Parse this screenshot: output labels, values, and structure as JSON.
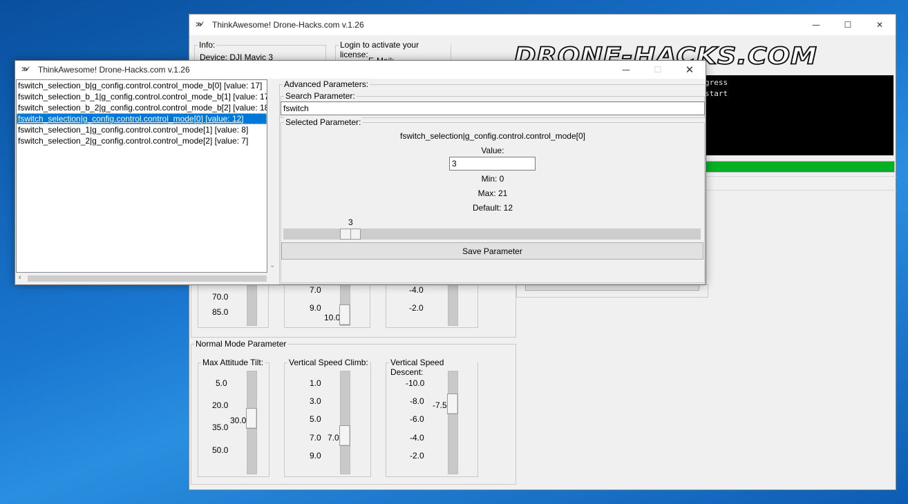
{
  "main_window": {
    "title": "ThinkAwesome! Drone-Hacks.com v.1.26",
    "app_icon": "drone-icon",
    "info_group_label": "Info:",
    "device_text": "Device: DJI Mavic 3",
    "login_group_label": "Login to activate your license:",
    "email_label": "E-Mail:",
    "logo_text": "DRONE-HACKS.COM",
    "console_lines": [
      "gress",
      "start"
    ],
    "progress_value": 1.0,
    "progress_color": "#06b025",
    "upper_sliders": {
      "col1_ticks": [
        "70.0",
        "85.0"
      ],
      "col2_ticks": [
        "7.0",
        "9.0"
      ],
      "col2_value": "10.0",
      "col3_ticks": [
        "-4.0",
        "-2.0"
      ]
    },
    "normal_mode": {
      "group_label": "Normal Mode Parameter",
      "max_tilt": {
        "label": "Max Attitude Tilt:",
        "ticks": [
          "5.0",
          "20.0",
          "35.0",
          "50.0"
        ],
        "value": "30.0"
      },
      "climb": {
        "label": "Vertical Speed Climb:",
        "ticks": [
          "1.0",
          "3.0",
          "5.0",
          "7.0",
          "9.0"
        ],
        "value": "7.0"
      },
      "descent": {
        "label": "Vertical Speed Descent:",
        "ticks": [
          "-10.0",
          "-8.0",
          "-6.0",
          "-4.0",
          "-2.0"
        ],
        "value": "-7.5"
      }
    }
  },
  "param_window": {
    "title": "ThinkAwesome! Drone-Hacks.com v.1.26",
    "list_items": [
      "fswitch_selection_b|g_config.control.control_mode_b[0] [value: 17]",
      "fswitch_selection_b_1|g_config.control.control_mode_b[1] [value: 17",
      "fswitch_selection_b_2|g_config.control.control_mode_b[2] [value: 18",
      "fswitch_selection|g_config.control.control_mode[0] [value: 12]",
      "fswitch_selection_1|g_config.control.control_mode[1] [value: 8]",
      "fswitch_selection_2|g_config.control.control_mode[2] [value: 7]"
    ],
    "selected_index": 3,
    "advanced_label": "Advanced Parameters:",
    "search_label": "Search Parameter:",
    "search_value": "fswitch",
    "selected_label": "Selected Parameter:",
    "selected_name": "fswitch_selection|g_config.control.control_mode[0]",
    "value_label": "Value:",
    "value_input": "3",
    "min_text": "Min: 0",
    "max_text": "Max: 21",
    "default_text": "Default: 12",
    "slider_value_text": "3",
    "slider": {
      "min": 0,
      "max": 21,
      "value": 3
    },
    "save_button": "Save Parameter"
  }
}
